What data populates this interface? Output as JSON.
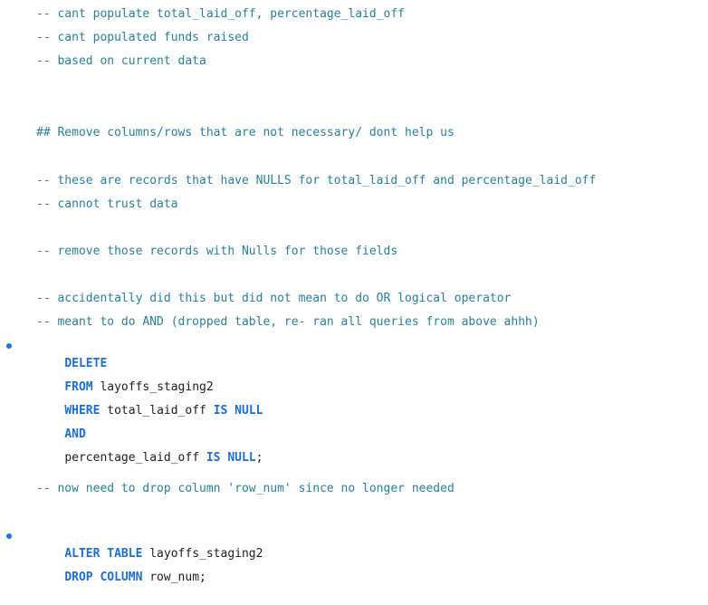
{
  "comments": {
    "c1": "-- cant populate total_laid_off, percentage_laid_off",
    "c2": "-- cant populated funds raised",
    "c3": "-- based on current data",
    "c4": "## Remove columns/rows that are not necessary/ dont help us",
    "c5": "-- these are records that have NULLS for total_laid_off and percentage_laid_off",
    "c6": "-- cannot trust data",
    "c7": "-- remove those records with Nulls for those fields",
    "c8": "-- accidentally did this but did not mean to do OR logical operator",
    "c9": "-- meant to do AND (dropped table, re- ran all queries from above ahhh)",
    "c10": "-- now need to drop column 'row_num' since no longer needed"
  },
  "delete_stmt": {
    "kw_delete": "DELETE",
    "kw_from": "FROM",
    "table": " layoffs_staging2",
    "kw_where": "WHERE",
    "col1": " total_laid_off ",
    "kw_is_null1": "IS NULL",
    "kw_and": "AND",
    "col2": "percentage_laid_off ",
    "kw_is_null2": "IS NULL",
    "end1": ";"
  },
  "alter_stmt": {
    "kw_alter_table": "ALTER TABLE",
    "table": " layoffs_staging2",
    "kw_drop_column": "DROP COLUMN",
    "col": " row_num",
    "end": ";"
  },
  "colors": {
    "comment": "#2a7f9b",
    "keyword": "#1c6fd0",
    "plain": "#1f1f1f",
    "run_marker": "#1a73e8"
  },
  "icons": {
    "run_marker": "run-statement-dot-icon"
  }
}
